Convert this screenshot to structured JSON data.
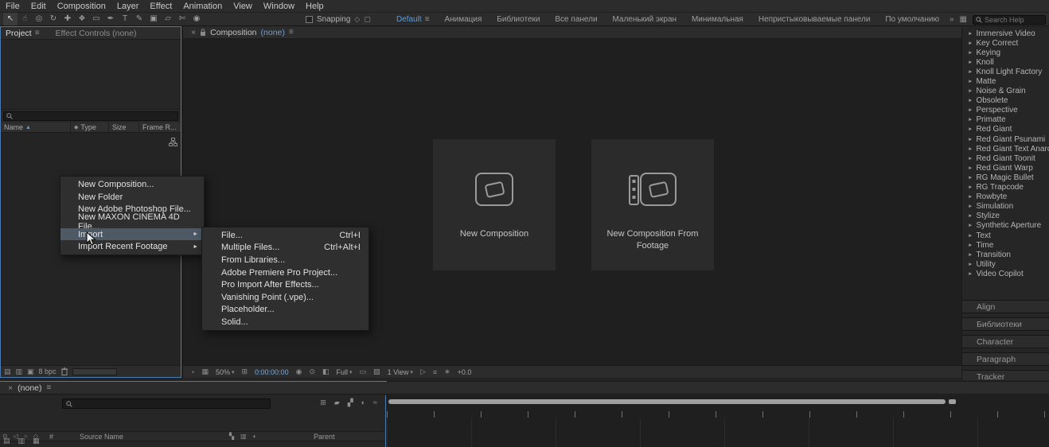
{
  "icons": {
    "hamburger": "≡",
    "close": "×",
    "caret_down": "▾",
    "submenu_arrow": "►",
    "category_arrow": "►",
    "sort_ascending": "▲",
    "chevron_double": "»",
    "panel_grid": "▦",
    "tag": "◆",
    "view_options": "◔",
    "grid_guides": "▦",
    "snapshot": "◉",
    "show_snapshot": "⊙",
    "channels": "◧",
    "region_of_interest": "▭",
    "transparency_grid": "▨",
    "pixel_aspect": "⊞",
    "fast_previews": "▷",
    "mini_timeline": "≡",
    "flowchart": "∗",
    "eye": "⊙",
    "audio": "◁",
    "solo": "○",
    "lock_col": "◇",
    "shy": "▰",
    "frame_blend": "▞",
    "motion_blur": "◐",
    "graph_editor": "≈",
    "brainstorm": "⊞",
    "interpret_footage": "▤",
    "new_folder_btn": "▥",
    "new_comp_btn": "▣",
    "snap_angle": "◇",
    "snap_frame": "▢",
    "transfer_controls": "▚",
    "switches_mode": "▥",
    "blend_col": "◐"
  },
  "menubar": {
    "items": [
      {
        "label": "File"
      },
      {
        "label": "Edit"
      },
      {
        "label": "Composition"
      },
      {
        "label": "Layer"
      },
      {
        "label": "Effect"
      },
      {
        "label": "Animation"
      },
      {
        "label": "View"
      },
      {
        "label": "Window"
      },
      {
        "label": "Help"
      }
    ]
  },
  "toolbar": {
    "tools": [
      {
        "name": "selection-tool-icon",
        "glyph": "↖",
        "active": true
      },
      {
        "name": "hand-tool-icon",
        "glyph": "☝"
      },
      {
        "name": "zoom-tool-icon",
        "glyph": "◎"
      },
      {
        "name": "orbit-camera-tool-icon",
        "glyph": "↻"
      },
      {
        "name": "pan-camera-tool-icon",
        "glyph": "✚"
      },
      {
        "name": "pan-behind-tool-icon",
        "glyph": "❖"
      },
      {
        "name": "mask-shape-tool-icon",
        "glyph": "▭"
      },
      {
        "name": "pen-tool-icon",
        "glyph": "✒"
      },
      {
        "name": "type-tool-icon",
        "glyph": "T"
      },
      {
        "name": "brush-tool-icon",
        "glyph": "✎"
      },
      {
        "name": "clone-stamp-tool-icon",
        "glyph": "▣"
      },
      {
        "name": "eraser-tool-icon",
        "glyph": "▱"
      },
      {
        "name": "roto-brush-tool-icon",
        "glyph": "✄"
      },
      {
        "name": "puppet-pin-tool-icon",
        "glyph": "◉"
      }
    ],
    "snapping_label": "Snapping",
    "workspaces": [
      {
        "label": "Default",
        "active": true
      },
      {
        "label": "Анимация"
      },
      {
        "label": "Библиотеки"
      },
      {
        "label": "Все панели"
      },
      {
        "label": "Маленький экран"
      },
      {
        "label": "Минимальная"
      },
      {
        "label": "Непристыковываемые панели"
      },
      {
        "label": "По умолчанию"
      }
    ],
    "search_placeholder": "Search Help"
  },
  "project_panel": {
    "tab_active": "Project",
    "tab_inactive": "Effect Controls (none)",
    "columns": {
      "name": "Name",
      "type": "Type",
      "size": "Size",
      "frame_rate": "Frame R..."
    },
    "bit_depth": "8 bpc"
  },
  "composition_panel": {
    "tab": {
      "label": "Composition",
      "none": "(none)"
    },
    "cards": [
      {
        "label": "New Composition"
      },
      {
        "label": "New Composition From Footage"
      }
    ],
    "statusbar": {
      "zoom": "50%",
      "timecode": "0:00:00:00",
      "resolution": "Full",
      "view_layout": "1 View",
      "exposure": "+0.0"
    }
  },
  "effects_panel": {
    "categories": [
      {
        "label": "Immersive Video"
      },
      {
        "label": "Key Correct"
      },
      {
        "label": "Keying"
      },
      {
        "label": "Knoll"
      },
      {
        "label": "Knoll Light Factory"
      },
      {
        "label": "Matte"
      },
      {
        "label": "Noise & Grain"
      },
      {
        "label": "Obsolete"
      },
      {
        "label": "Perspective"
      },
      {
        "label": "Primatte"
      },
      {
        "label": "Red Giant"
      },
      {
        "label": "Red Giant Psunami"
      },
      {
        "label": "Red Giant Text Anarchy"
      },
      {
        "label": "Red Giant Toonit"
      },
      {
        "label": "Red Giant Warp"
      },
      {
        "label": "RG Magic Bullet"
      },
      {
        "label": "RG Trapcode"
      },
      {
        "label": "Rowbyte"
      },
      {
        "label": "Simulation"
      },
      {
        "label": "Stylize"
      },
      {
        "label": "Synthetic Aperture"
      },
      {
        "label": "Text"
      },
      {
        "label": "Time"
      },
      {
        "label": "Transition"
      },
      {
        "label": "Utility"
      },
      {
        "label": "Video Copilot"
      }
    ]
  },
  "side_panels": [
    {
      "label": "Align"
    },
    {
      "label": "Библиотеки"
    },
    {
      "label": "Character"
    },
    {
      "label": "Paragraph"
    },
    {
      "label": "Tracker"
    }
  ],
  "timeline_panel": {
    "tab": {
      "label": "(none)"
    },
    "columns": {
      "number": "#",
      "source_name": "Source Name",
      "parent": "Parent"
    }
  },
  "context_menu": {
    "items": [
      {
        "label": "New Composition...",
        "highlighted": false,
        "has_submenu": false
      },
      {
        "label": "New Folder",
        "highlighted": false,
        "has_submenu": false
      },
      {
        "label": "New Adobe Photoshop File...",
        "highlighted": false,
        "has_submenu": false
      },
      {
        "label": "New MAXON CINEMA 4D File...",
        "highlighted": false,
        "has_submenu": false
      },
      {
        "label": "Import",
        "highlighted": true,
        "has_submenu": true
      },
      {
        "label": "Import Recent Footage",
        "highlighted": false,
        "has_submenu": true
      }
    ]
  },
  "import_submenu": {
    "items": [
      {
        "label": "File...",
        "shortcut": "Ctrl+I"
      },
      {
        "label": "Multiple Files...",
        "shortcut": "Ctrl+Alt+I"
      },
      {
        "label": "From Libraries...",
        "shortcut": ""
      },
      {
        "label": "Adobe Premiere Pro Project...",
        "shortcut": ""
      },
      {
        "label": "Pro Import After Effects...",
        "shortcut": ""
      },
      {
        "label": "Vanishing Point (.vpe)...",
        "shortcut": ""
      },
      {
        "label": "Placeholder...",
        "shortcut": ""
      },
      {
        "label": "Solid...",
        "shortcut": ""
      }
    ]
  },
  "colors": {
    "panel_outline": "#4a7ab0",
    "workspace_active": "#5f9bd5",
    "menu_highlight": "#4d5a66",
    "timecode": "#7ba7d7",
    "tab_none_blue": "#6f9fce"
  }
}
